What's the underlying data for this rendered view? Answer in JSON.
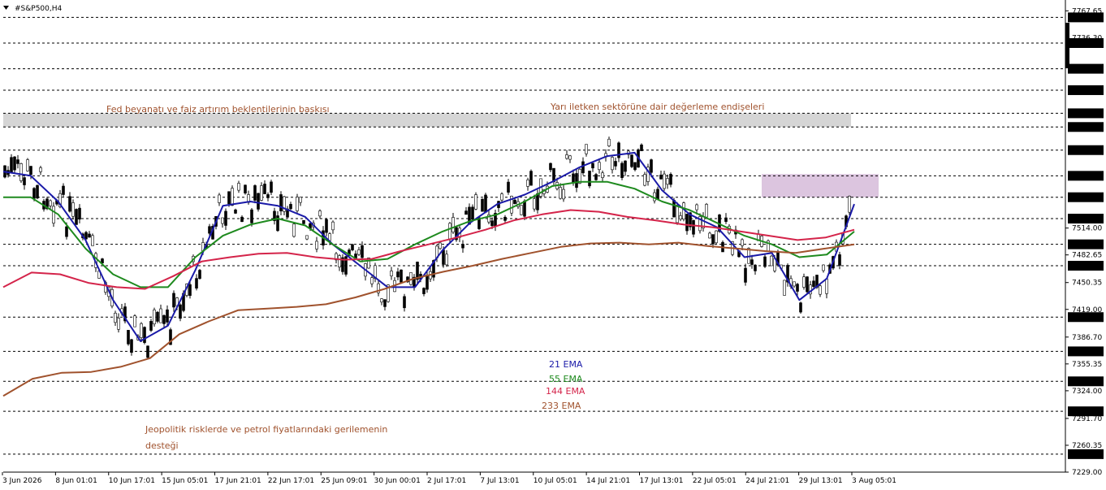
{
  "symbol_label": "#S&P500,H4",
  "colors": {
    "ema21": "#1a1aa8",
    "ema55": "#1e8a1e",
    "ema144": "#d4244a",
    "ema233": "#a0522d",
    "annotation": "#a0522d",
    "resistance_zone": "#d0d0d0",
    "support_zone": "#d8bfdc",
    "candle": "#000000"
  },
  "annotations": {
    "top_left": "Fed beyanatı ve faiz artırım beklentilerinin baskısı",
    "top_right": "Yarı iletken sektörüne dair değerleme endişeleri",
    "bottom_line1": "Jeopolitik risklerde ve petrol fiyatlarındaki gerilemenin",
    "bottom_line2": "desteği"
  },
  "legend": {
    "ema21": "21 EMA",
    "ema55": "55 EMA",
    "ema144": "144 EMA",
    "ema233": "233 EMA"
  },
  "chart_data": {
    "type": "line",
    "ylim": [
      7229.0,
      7767.0
    ],
    "grid": "horizontal dashed",
    "y_ticks": [
      "7767.65",
      "7736.30",
      "7514.00",
      "7482.65",
      "7450.35",
      "7419.00",
      "7386.70",
      "7355.35",
      "7324.00",
      "7291.70",
      "7260.35",
      "7229.00"
    ],
    "y_levels": [
      "7760.00",
      "7730.00",
      "7700.00",
      "7675.00",
      "7648.00",
      "7632.00",
      "7605.00",
      "7575.00",
      "7550.00",
      "7525.00",
      "7495.00",
      "7470.00",
      "7410.00",
      "7370.00",
      "7335.00",
      "7300.00",
      "7250.00"
    ],
    "x_ticks": [
      "3 Jun 2026",
      "8 Jun 01:01",
      "10 Jun 17:01",
      "15 Jun 05:01",
      "17 Jun 21:01",
      "22 Jun 17:01",
      "25 Jun 09:01",
      "30 Jun 00:01",
      "2 Jul 17:01",
      "7 Jul 13:01",
      "10 Jul 05:01",
      "14 Jul 21:01",
      "17 Jul 13:01",
      "22 Jul 05:01",
      "24 Jul 21:01",
      "29 Jul 13:01",
      "3 Aug 05:01"
    ],
    "zones": [
      {
        "name": "resistance",
        "low": 7632.0,
        "high": 7648.0
      },
      {
        "name": "support",
        "low": 7550.0,
        "high": 7577.0
      }
    ],
    "series": [
      {
        "name": "21 EMA",
        "values": [
          7580,
          7575,
          7545,
          7500,
          7430,
          7382,
          7400,
          7465,
          7540,
          7545,
          7540,
          7527,
          7495,
          7470,
          7445,
          7445,
          7488,
          7520,
          7542,
          7553,
          7568,
          7585,
          7598,
          7602,
          7558,
          7530,
          7515,
          7480,
          7485,
          7430,
          7455,
          7542
        ]
      },
      {
        "name": "55 EMA",
        "values": [
          7550,
          7550,
          7530,
          7490,
          7460,
          7445,
          7445,
          7480,
          7505,
          7518,
          7525,
          7517,
          7495,
          7475,
          7478,
          7495,
          7510,
          7522,
          7530,
          7545,
          7563,
          7568,
          7568,
          7560,
          7545,
          7535,
          7520,
          7505,
          7495,
          7480,
          7483,
          7510
        ]
      },
      {
        "name": "144 EMA",
        "values": [
          7445,
          7462,
          7460,
          7450,
          7445,
          7443,
          7458,
          7475,
          7480,
          7484,
          7485,
          7480,
          7477,
          7478,
          7487,
          7495,
          7503,
          7512,
          7523,
          7530,
          7535,
          7533,
          7527,
          7523,
          7518,
          7515,
          7510,
          7505,
          7500,
          7503,
          7512
        ]
      },
      {
        "name": "233 EMA",
        "values": [
          7318,
          7338,
          7345,
          7346,
          7352,
          7362,
          7390,
          7405,
          7418,
          7420,
          7422,
          7425,
          7433,
          7443,
          7455,
          7463,
          7470,
          7478,
          7485,
          7492,
          7496,
          7497,
          7495,
          7497,
          7493,
          7490,
          7487,
          7485,
          7490,
          7495
        ]
      }
    ]
  }
}
